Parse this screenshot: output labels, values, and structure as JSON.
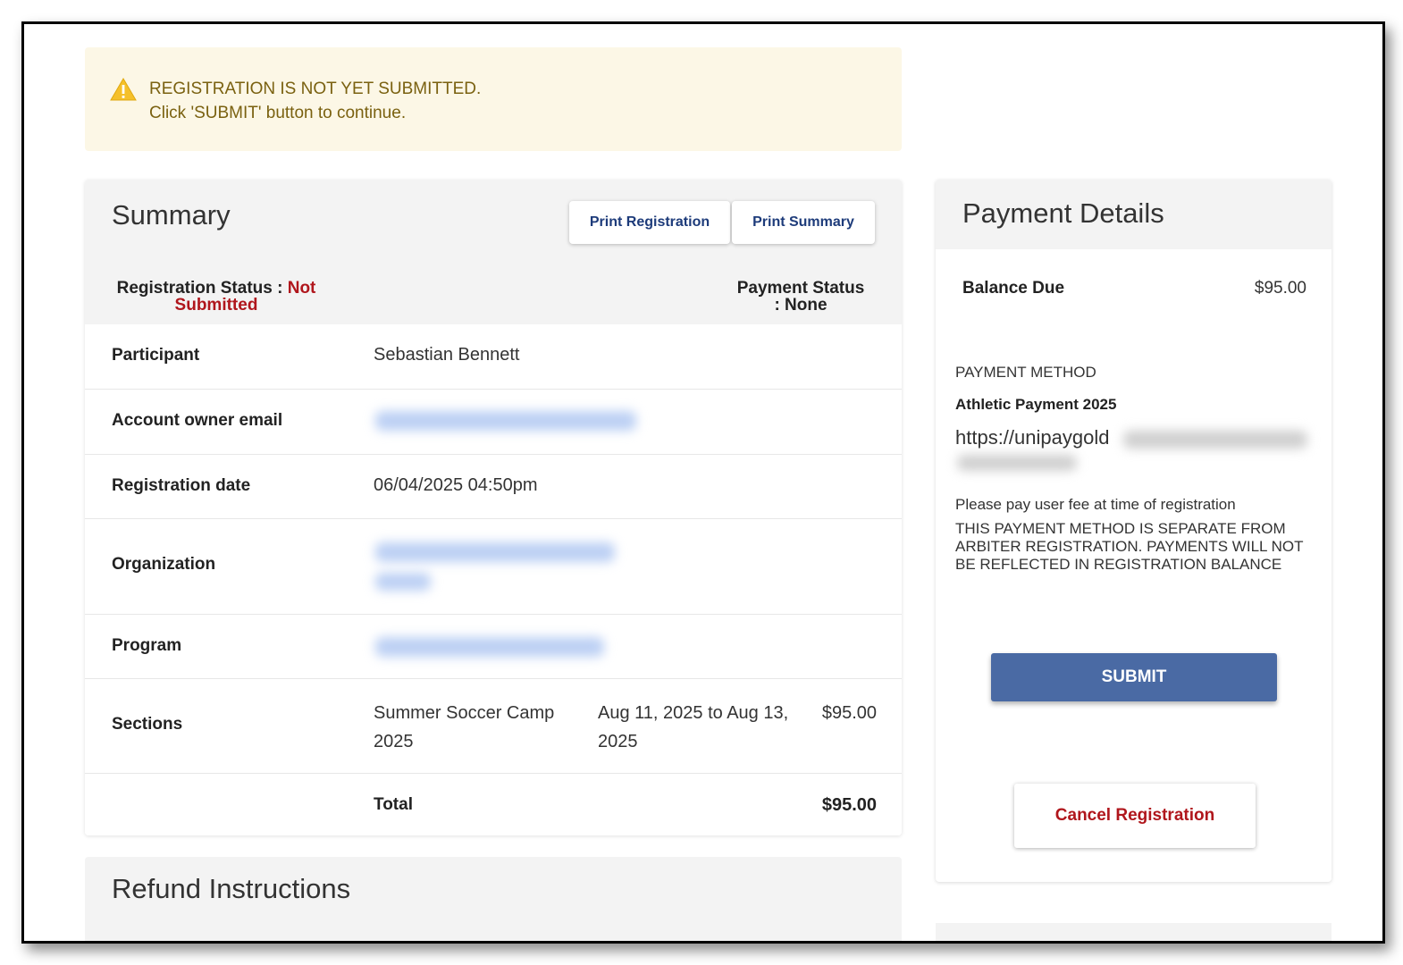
{
  "alert": {
    "line1": "REGISTRATION IS NOT YET SUBMITTED.",
    "line2": "Click 'SUBMIT' button to continue.",
    "icon": "warning-icon",
    "color": "#7a6110"
  },
  "summary": {
    "title": "Summary",
    "print_registration": "Print Registration",
    "print_summary": "Print Summary",
    "registration_status_label": "Registration Status :",
    "registration_status_value": "Not Submitted",
    "payment_status_label": "Payment Status",
    "payment_status_value": ": None",
    "rows": {
      "participant": {
        "label": "Participant",
        "value": "Sebastian Bennett"
      },
      "email": {
        "label": "Account owner email"
      },
      "reg_date": {
        "label": "Registration date",
        "value": "06/04/2025 04:50pm"
      },
      "organization": {
        "label": "Organization"
      },
      "program": {
        "label": "Program"
      },
      "sections": {
        "label": "Sections",
        "name": "Summer Soccer Camp 2025",
        "dates": "Aug 11, 2025 to Aug 13, 2025",
        "price": "$95.00"
      },
      "total": {
        "label": "Total",
        "value": "$95.00"
      }
    }
  },
  "refund": {
    "title": "Refund Instructions"
  },
  "payment": {
    "title": "Payment Details",
    "balance_label": "Balance Due",
    "balance_value": "$95.00",
    "method_heading": "PAYMENT METHOD",
    "method_name": "Athletic Payment 2025",
    "method_url": "https://unipaygold",
    "method_note": "Please pay user fee at time of registration",
    "method_warning": "THIS PAYMENT METHOD IS SEPARATE FROM ARBITER REGISTRATION. PAYMENTS WILL NOT BE REFLECTED IN REGISTRATION BALANCE",
    "submit_label": "SUBMIT",
    "cancel_label": "Cancel Registration"
  },
  "colors": {
    "accent_blue": "#4a6aa4",
    "status_red": "#b0161c",
    "alert_bg": "#fcf7e6"
  }
}
